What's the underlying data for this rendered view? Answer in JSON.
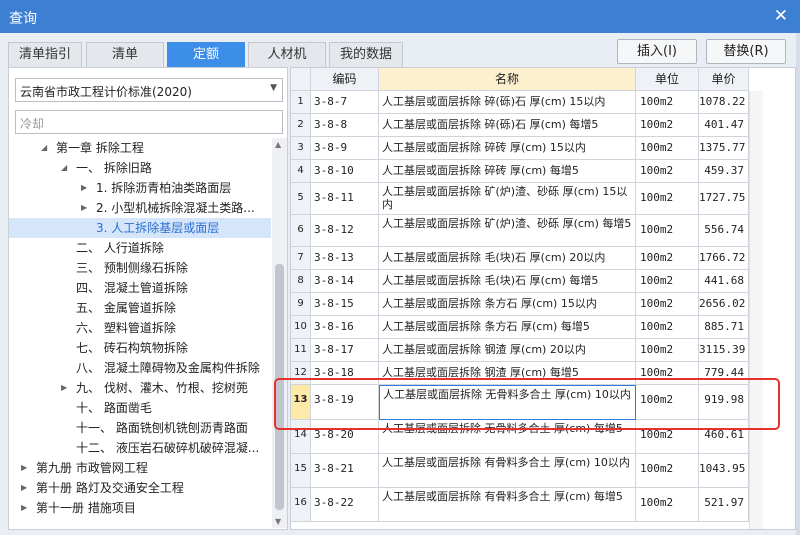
{
  "window": {
    "title": "查询"
  },
  "tabs": [
    {
      "label": "清单指引"
    },
    {
      "label": "清单"
    },
    {
      "label": "定额"
    },
    {
      "label": "人材机"
    },
    {
      "label": "我的数据"
    }
  ],
  "buttons": {
    "insert": "插入(I)",
    "replace": "替换(R)"
  },
  "left": {
    "standard": "云南省市政工程计价标准(2020)",
    "search_value": "冷却",
    "tree": [
      {
        "label": "第一章 拆除工程",
        "twisty": "◢"
      },
      {
        "label": "一、 拆除旧路",
        "twisty": "◢"
      },
      {
        "label": "1. 拆除沥青柏油类路面层",
        "twisty": "▶"
      },
      {
        "label": "2. 小型机械拆除混凝土类路...",
        "twisty": "▶"
      },
      {
        "label": "3. 人工拆除基层或面层",
        "twisty": ""
      },
      {
        "label": "二、 人行道拆除",
        "twisty": ""
      },
      {
        "label": "三、 预制侧缘石拆除",
        "twisty": ""
      },
      {
        "label": "四、 混凝土管道拆除",
        "twisty": ""
      },
      {
        "label": "五、 金属管道拆除",
        "twisty": ""
      },
      {
        "label": "六、 塑料管道拆除",
        "twisty": ""
      },
      {
        "label": "七、 砖石构筑物拆除",
        "twisty": ""
      },
      {
        "label": "八、 混凝土障碍物及金属构件拆除",
        "twisty": ""
      },
      {
        "label": "九、 伐树、灌木、竹根、挖树蔸",
        "twisty": "▶"
      },
      {
        "label": "十、 路面凿毛",
        "twisty": ""
      },
      {
        "label": "十一、 路面铣刨机铣刨沥青路面",
        "twisty": ""
      },
      {
        "label": "十二、 液压岩石破碎机破碎混凝...",
        "twisty": ""
      },
      {
        "label": "第九册 市政管网工程",
        "twisty": "▶"
      },
      {
        "label": "第十册 路灯及交通安全工程",
        "twisty": "▶"
      },
      {
        "label": "第十一册 措施项目",
        "twisty": "▶"
      }
    ]
  },
  "table": {
    "columns": {
      "code": "编码",
      "name": "名称",
      "unit": "单位",
      "price": "单价"
    },
    "rows": [
      {
        "idx": "1",
        "code": "3-8-7",
        "name": "人工基层或面层拆除 碎(砾)石 厚(cm) 15以内",
        "unit": "100m2",
        "price": "1078.22"
      },
      {
        "idx": "2",
        "code": "3-8-8",
        "name": "人工基层或面层拆除 碎(砾)石 厚(cm) 每增5",
        "unit": "100m2",
        "price": "401.47"
      },
      {
        "idx": "3",
        "code": "3-8-9",
        "name": "人工基层或面层拆除 碎砖 厚(cm) 15以内",
        "unit": "100m2",
        "price": "1375.77"
      },
      {
        "idx": "4",
        "code": "3-8-10",
        "name": "人工基层或面层拆除 碎砖 厚(cm) 每增5",
        "unit": "100m2",
        "price": "459.37"
      },
      {
        "idx": "5",
        "code": "3-8-11",
        "name": "人工基层或面层拆除 矿(炉)渣、砂砾 厚(cm) 15以内",
        "unit": "100m2",
        "price": "1727.75"
      },
      {
        "idx": "6",
        "code": "3-8-12",
        "name": "人工基层或面层拆除 矿(炉)渣、砂砾 厚(cm) 每增5",
        "unit": "100m2",
        "price": "556.74"
      },
      {
        "idx": "7",
        "code": "3-8-13",
        "name": "人工基层或面层拆除 毛(块)石 厚(cm) 20以内",
        "unit": "100m2",
        "price": "1766.72"
      },
      {
        "idx": "8",
        "code": "3-8-14",
        "name": "人工基层或面层拆除 毛(块)石 厚(cm) 每增5",
        "unit": "100m2",
        "price": "441.68"
      },
      {
        "idx": "9",
        "code": "3-8-15",
        "name": "人工基层或面层拆除 条方石 厚(cm) 15以内",
        "unit": "100m2",
        "price": "2656.02"
      },
      {
        "idx": "10",
        "code": "3-8-16",
        "name": "人工基层或面层拆除 条方石 厚(cm) 每增5",
        "unit": "100m2",
        "price": "885.71"
      },
      {
        "idx": "11",
        "code": "3-8-17",
        "name": "人工基层或面层拆除 钢渣 厚(cm) 20以内",
        "unit": "100m2",
        "price": "3115.39"
      },
      {
        "idx": "12",
        "code": "3-8-18",
        "name": "人工基层或面层拆除 钢渣 厚(cm) 每增5",
        "unit": "100m2",
        "price": "779.44"
      },
      {
        "idx": "13",
        "code": "3-8-19",
        "name": "人工基层或面层拆除 无骨料多合土 厚(cm) 10以内",
        "unit": "100m2",
        "price": "919.98"
      },
      {
        "idx": "14",
        "code": "3-8-20",
        "name": "人工基层或面层拆除 无骨料多合土 厚(cm) 每增5",
        "unit": "100m2",
        "price": "460.61"
      },
      {
        "idx": "15",
        "code": "3-8-21",
        "name": "人工基层或面层拆除 有骨料多合土 厚(cm) 10以内",
        "unit": "100m2",
        "price": "1043.95"
      },
      {
        "idx": "16",
        "code": "3-8-22",
        "name": "人工基层或面层拆除 有骨料多合土 厚(cm) 每增5",
        "unit": "100m2",
        "price": "521.97"
      }
    ]
  }
}
